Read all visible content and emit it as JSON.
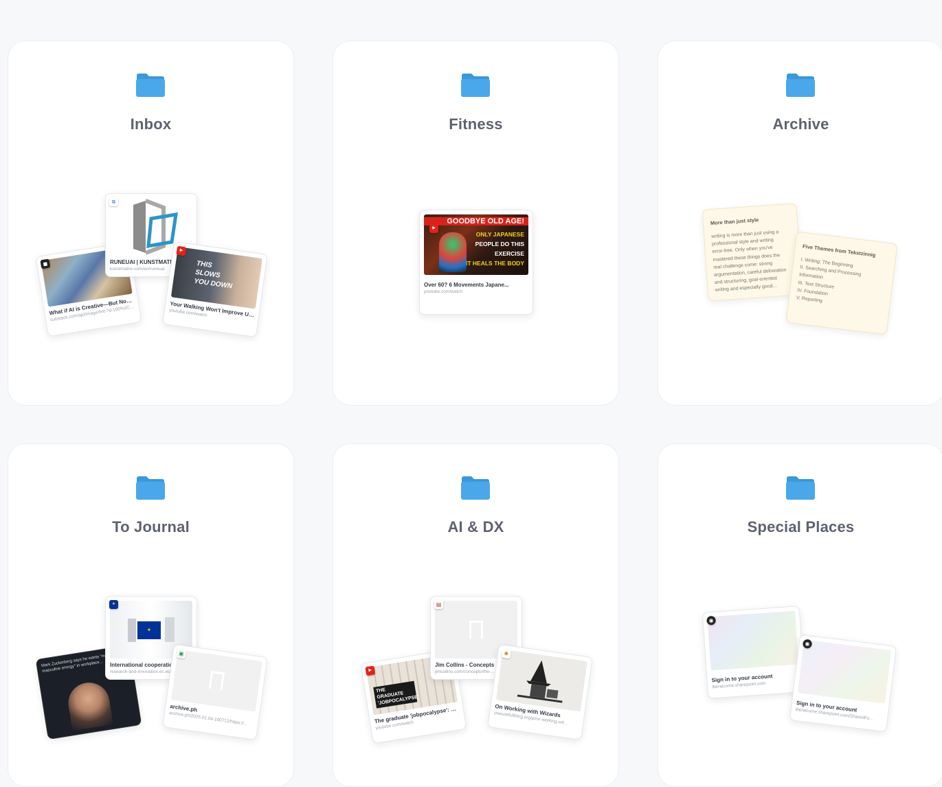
{
  "folders": [
    {
      "title": "Inbox",
      "previews": [
        {
          "title": "What if AI is Creative—But Not I...",
          "url": "substack.com/api/image/fmt-?d-100%2Cf..."
        },
        {
          "title": "RUNEUAI | KUNSTMATRIX",
          "url": "kunstmatrix.com/en/runeuai"
        },
        {
          "title": "Your Walking Won't Improve Un...",
          "url": "youtube.com/watch",
          "overlay": "THIS SLOWS YOU DOWN"
        }
      ]
    },
    {
      "title": "Fitness",
      "previews": [
        {
          "title": "Over 60? 6 Movements Japane...",
          "url": "youtube.com/watch",
          "overlay": [
            "GOODBYE OLD AGE!",
            "ONLY JAPANESE",
            "PEOPLE DO THIS",
            "EXERCISE",
            "IT HEALS THE BODY"
          ]
        }
      ]
    },
    {
      "title": "Archive",
      "notes": [
        {
          "head": "More than just style",
          "lines": [
            "writing is more than just using a",
            "professional style and writing",
            "error-free. Only when you've",
            "mastered these things does the",
            "real challenge come: strong",
            "argumentation, careful delineation",
            "and structuring, goal-oriented",
            "writing and especially good..."
          ]
        },
        {
          "head": "Five Themes from Tekstzinnig",
          "lines": [
            "I. Writing: The Beginning",
            "II. Searching and Processing",
            "Information",
            "III. Text Structure",
            "IV. Foundation",
            "V. Reporting"
          ]
        }
      ]
    },
    {
      "title": "To Journal",
      "previews": [
        {
          "title": "",
          "url": "",
          "overlay": "Mark Zuckerberg says he wants \"more masculine energy\" in workplace..."
        },
        {
          "title": "International cooperation",
          "url": "research-and-innovation.ec.europa.eu"
        },
        {
          "title": "archive.ph",
          "url": "archive.ph/2025.01.04-100712/https://..."
        }
      ]
    },
    {
      "title": "AI & DX",
      "previews": [
        {
          "title": "The graduate 'jobpocalypse': W...",
          "url": "youtube.com/watch",
          "overlay": "THE GRADUATE 'JOBPOCALYPSE'"
        },
        {
          "title": "Jim Collins - Concepts - T...",
          "url": "jimcollins.com/concepts/the-..."
        },
        {
          "title": "On Working with Wizards",
          "url": "oneusefulthing.org/p/on-working-wit..."
        }
      ]
    },
    {
      "title": "Special Places",
      "previews": [
        {
          "title": "Sign in to your account",
          "url": "iberalcome.sharepoint.com"
        },
        {
          "title": "Sign in to your account",
          "url": "iberalcome.sharepoint.com/SharedFo..."
        }
      ]
    }
  ],
  "colors": {
    "folder": "#4aa8ea",
    "folder_tab": "#3a98db",
    "background": "#f7f8fa",
    "card": "#ffffff",
    "note": "#fdf8e8"
  }
}
